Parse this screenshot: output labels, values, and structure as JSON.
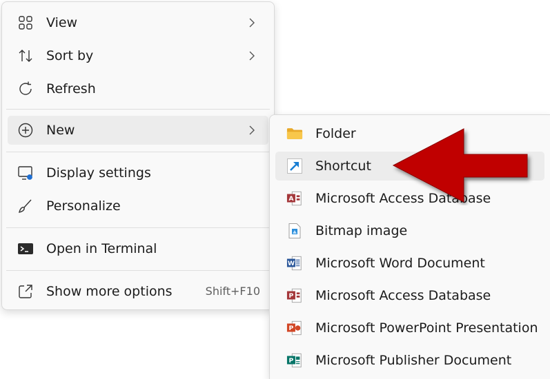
{
  "main_menu": {
    "items": [
      {
        "label": "View",
        "icon": "grid-icon"
      },
      {
        "label": "Sort by",
        "icon": "sort-icon"
      },
      {
        "label": "Refresh",
        "icon": "refresh-icon"
      },
      {
        "label": "New",
        "icon": "plus-circle-icon"
      },
      {
        "label": "Display settings",
        "icon": "display-settings-icon"
      },
      {
        "label": "Personalize",
        "icon": "brush-icon"
      },
      {
        "label": "Open in Terminal",
        "icon": "terminal-icon"
      },
      {
        "label": "Show more options",
        "icon": "share-window-icon",
        "shortcut": "Shift+F10"
      }
    ]
  },
  "new_submenu": {
    "items": [
      {
        "label": "Folder",
        "icon": "folder-icon"
      },
      {
        "label": "Shortcut",
        "icon": "shortcut-icon"
      },
      {
        "label": "Microsoft Access Database",
        "icon": "access-icon"
      },
      {
        "label": "Bitmap image",
        "icon": "bitmap-icon"
      },
      {
        "label": "Microsoft Word Document",
        "icon": "word-icon"
      },
      {
        "label": "Microsoft Access Database",
        "icon": "access-icon"
      },
      {
        "label": "Microsoft PowerPoint Presentation",
        "icon": "powerpoint-icon"
      },
      {
        "label": "Microsoft Publisher Document",
        "icon": "publisher-icon"
      }
    ]
  },
  "colors": {
    "highlight": "#ececec",
    "annotation_arrow": "#c00000",
    "access": "#a4373a",
    "word": "#2b579a",
    "powerpoint": "#d24726",
    "publisher": "#077568",
    "folder": "#f8c74b"
  }
}
